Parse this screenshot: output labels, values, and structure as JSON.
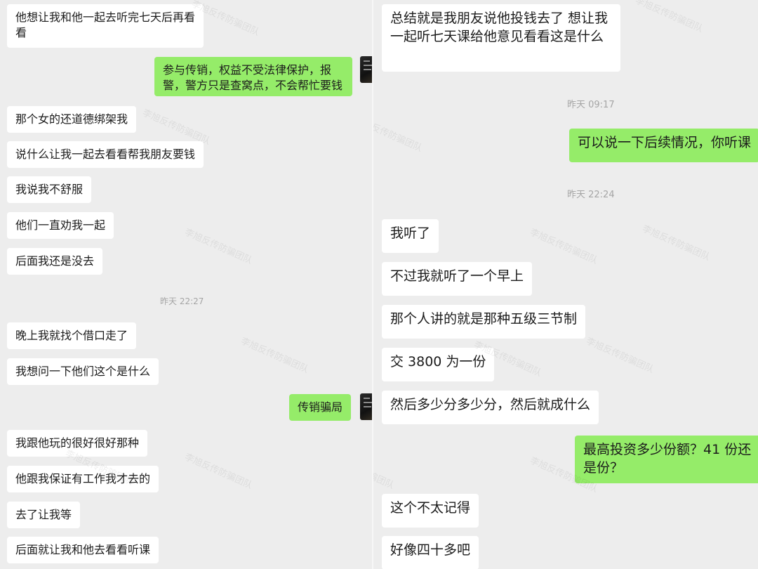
{
  "left": {
    "messages": [
      {
        "text": "他想让我和他一起去听完七天后再看看"
      },
      {
        "text": "参与传销，权益不受法律保护，报警，警方只是查窝点，不会帮忙要钱"
      },
      {
        "text": "那个女的还道德绑架我"
      },
      {
        "text": "说什么让我一起去看看帮我朋友要钱"
      },
      {
        "text": "我说我不舒服"
      },
      {
        "text": "他们一直劝我一起"
      },
      {
        "text": "后面我还是没去"
      },
      {
        "text": "晚上我就找个借口走了"
      },
      {
        "text": "我想问一下他们这个是什么"
      },
      {
        "text": "传销骗局"
      },
      {
        "text": "我跟他玩的很好很好那种"
      },
      {
        "text": "他跟我保证有工作我才去的"
      },
      {
        "text": "去了让我等"
      },
      {
        "text": "后面就让我和他去看看听课"
      }
    ],
    "timestamps": [
      "昨天 22:27"
    ]
  },
  "right": {
    "messages": [
      {
        "text": "总结就是我朋友说他投钱去了 想让我一起听七天课给他意见看看这是什么"
      },
      {
        "text": "可以说一下后续情况，你听课"
      },
      {
        "text": "我听了"
      },
      {
        "text": "不过我就听了一个早上"
      },
      {
        "text": "那个人讲的就是那种五级三节制"
      },
      {
        "text": "交 3800 为一份"
      },
      {
        "text": "然后多少分多少分，然后就成什么"
      },
      {
        "text": "最高投资多少份额？41 份还是份？"
      },
      {
        "text": "这个不太记得"
      },
      {
        "text": "好像四十多吧"
      }
    ],
    "timestamps": [
      "昨天 09:17",
      "昨天 22:24"
    ]
  },
  "watermark": "李旭反传防骗团队",
  "colors": {
    "background": "#ededed",
    "incoming_bubble": "#ffffff",
    "outgoing_bubble": "#95ec69",
    "timestamp": "#a5a5a5"
  },
  "icons": {
    "avatar": "counselor-avatar"
  }
}
